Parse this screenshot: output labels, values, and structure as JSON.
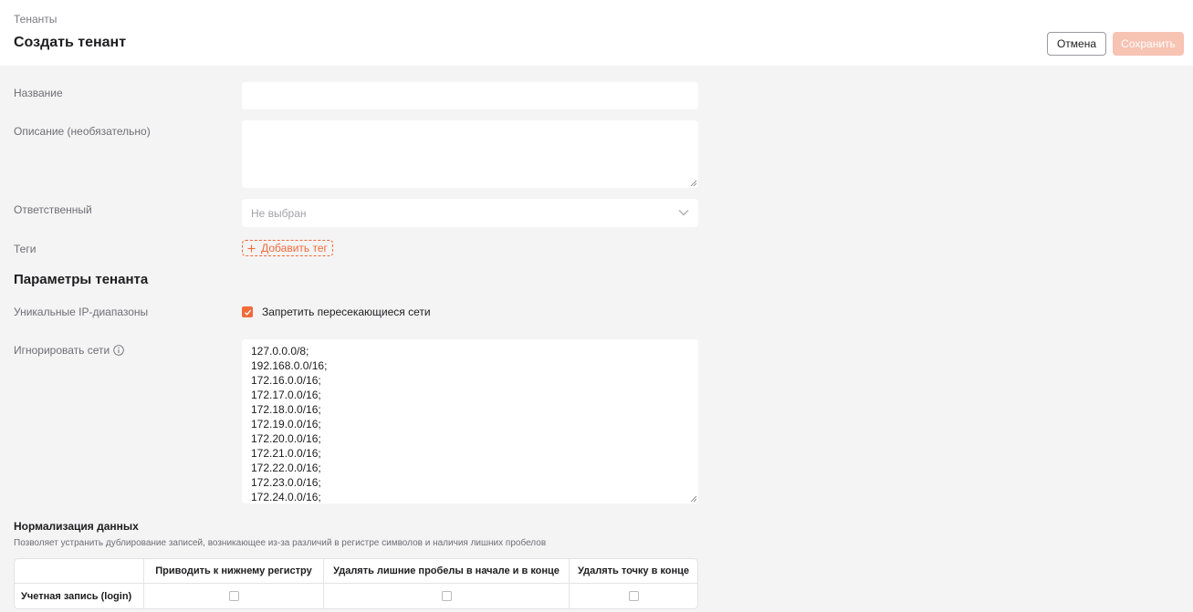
{
  "header": {
    "breadcrumb": "Тенанты",
    "title": "Создать тенант",
    "cancel_label": "Отмена",
    "save_label": "Сохранить"
  },
  "form": {
    "name_label": "Название",
    "name_value": "",
    "description_label": "Описание (необязательно)",
    "description_value": "",
    "owner_label": "Ответственный",
    "owner_placeholder": "Не выбран",
    "tags_label": "Теги",
    "add_tag_label": "Добавить тег"
  },
  "tenant_params": {
    "title": "Параметры тенанта",
    "unique_ip_label": "Уникальные IP-диапазоны",
    "forbid_overlap_label": "Запретить пересекающиеся сети",
    "forbid_overlap_checked": true,
    "ignore_networks_label": "Игнорировать сети",
    "ignore_networks": [
      "127.0.0.0/8;",
      "192.168.0.0/16;",
      "172.16.0.0/16;",
      "172.17.0.0/16;",
      "172.18.0.0/16;",
      "172.19.0.0/16;",
      "172.20.0.0/16;",
      "172.21.0.0/16;",
      "172.22.0.0/16;",
      "172.23.0.0/16;",
      "172.24.0.0/16;"
    ]
  },
  "normalization": {
    "title": "Нормализация данных",
    "subtitle": "Позволяет устранить дублирование записей, возникающее из-за различий в регистре символов и наличия лишних пробелов",
    "columns": [
      "",
      "Приводить к нижнему регистру",
      "Удалять лишние пробелы в начале и в конце",
      "Удалять точку в конце"
    ],
    "rows": [
      {
        "label": "Учетная запись (login)",
        "lowercase": false,
        "trim_spaces": false,
        "remove_dot": false
      }
    ]
  },
  "colors": {
    "accent": "#f26b3a",
    "save_disabled": "#f7c3b3",
    "background": "#f4f4f5"
  }
}
